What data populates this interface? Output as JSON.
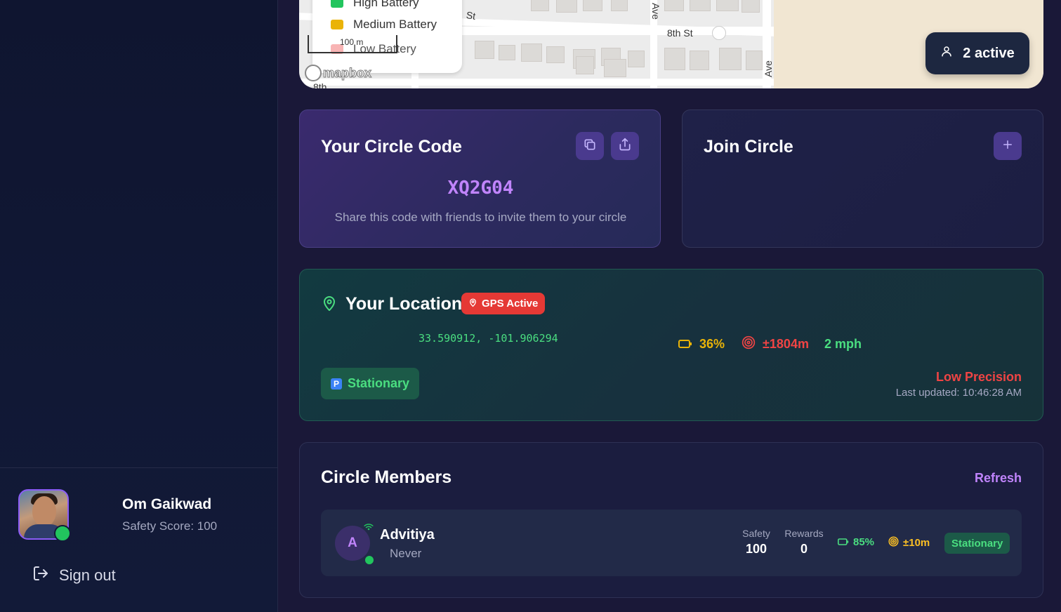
{
  "sidebar": {
    "user": {
      "name": "Om Gaikwad",
      "safety_score": "Safety Score: 100",
      "status": "online"
    },
    "sign_out_label": "Sign out",
    "sign_out_icon": "logout-icon"
  },
  "map": {
    "legend": [
      {
        "label": "High Battery",
        "color": "#22c55e"
      },
      {
        "label": "Medium Battery",
        "color": "#eab308"
      },
      {
        "label": "Low Battery",
        "color": "#f87171"
      }
    ],
    "streets": [
      "St",
      "8th St",
      "Ave",
      "Ave",
      "8th"
    ],
    "scale_label": "100 m",
    "attribution": "mapbox",
    "active_count": "2 active"
  },
  "circle_code": {
    "title": "Your Circle Code",
    "code": "XQ2G04",
    "hint": "Share this code with friends to invite them to your circle",
    "copy_icon": "copy-icon",
    "share_icon": "share-icon"
  },
  "join_circle": {
    "title": "Join Circle",
    "add_icon": "plus-icon"
  },
  "location": {
    "title": "Your Location",
    "gps_badge": "GPS Active",
    "coords": "33.590912, -101.906294",
    "battery": "36%",
    "accuracy": "±1804m",
    "speed": "2 mph",
    "motion_status": "Stationary",
    "precision": "Low Precision",
    "last_updated": "Last updated: 10:46:28 AM",
    "colors": {
      "battery": "#eab308",
      "accuracy": "#f04444",
      "speed": "#4ade80"
    }
  },
  "members": {
    "title": "Circle Members",
    "refresh_label": "Refresh",
    "list": [
      {
        "initial": "A",
        "name": "Advitiya",
        "last_seen": "Never",
        "safety_label": "Safety",
        "safety_value": "100",
        "rewards_label": "Rewards",
        "rewards_value": "0",
        "battery": "85%",
        "accuracy": "±10m",
        "status": "Stationary"
      }
    ]
  }
}
